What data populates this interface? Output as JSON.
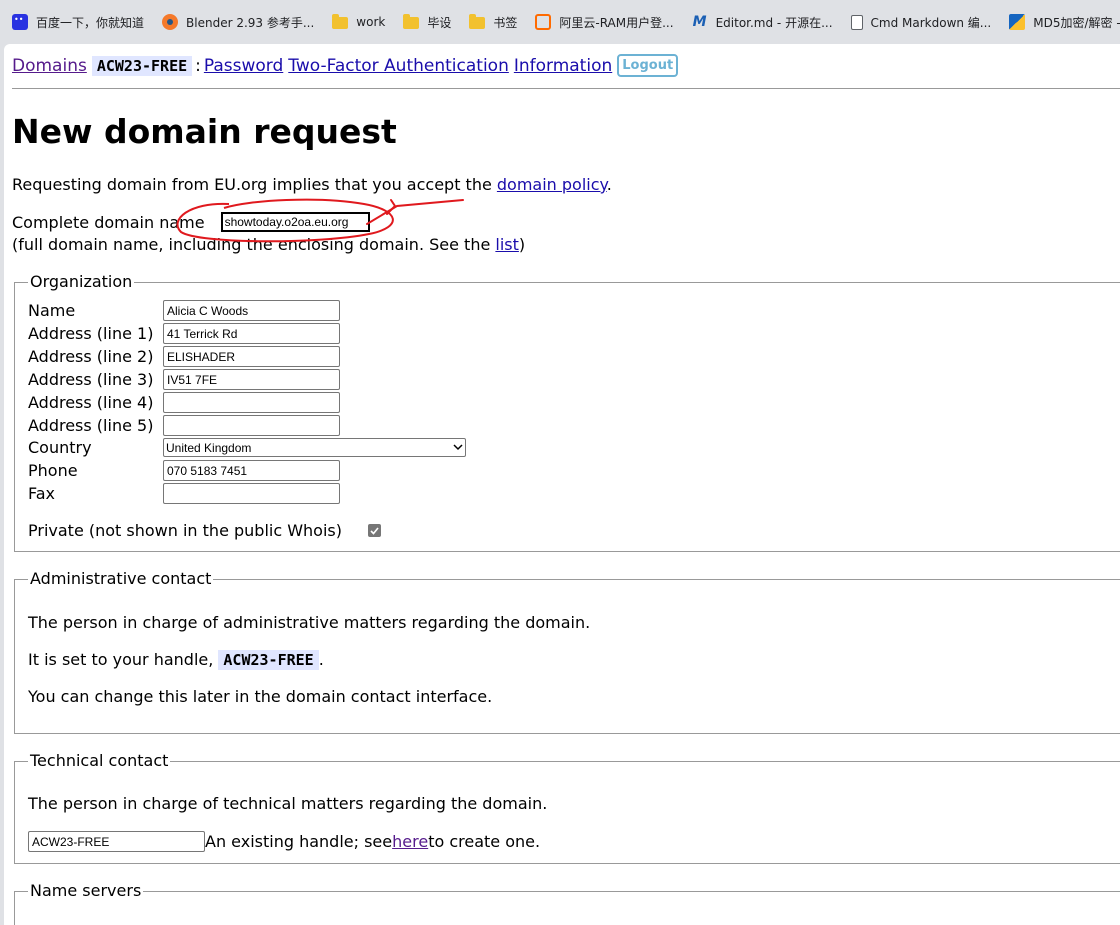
{
  "bookmarks": [
    {
      "label": "百度一下，你就知道",
      "icon": "baidu-icon"
    },
    {
      "label": "Blender 2.93 参考手...",
      "icon": "blender-icon"
    },
    {
      "label": "work",
      "icon": "folder-icon"
    },
    {
      "label": "毕设",
      "icon": "folder-icon"
    },
    {
      "label": "书签",
      "icon": "folder-icon"
    },
    {
      "label": "阿里云-RAM用户登...",
      "icon": "aliyun-icon"
    },
    {
      "label": "Editor.md - 开源在...",
      "icon": "editormd-icon"
    },
    {
      "label": "Cmd Markdown 编...",
      "icon": "document-icon"
    },
    {
      "label": "MD5加密/解密 - 站...",
      "icon": "md5-icon"
    }
  ],
  "nav": {
    "domains": "Domains",
    "handle": "ACW23-FREE",
    "sep": ":",
    "password": "Password",
    "two_factor": "Two-Factor Authentication",
    "information": "Information",
    "logout": "Logout"
  },
  "title": "New domain request",
  "intro": {
    "text": "Requesting domain from EU.org implies that you accept the ",
    "link": "domain policy",
    "end": "."
  },
  "domain": {
    "label": "Complete domain name",
    "value": "showtoday.o2oa.eu.org",
    "help_pre": "(full domain name, including the enclosing domain. See the ",
    "help_link": "list",
    "help_post": ")"
  },
  "organization": {
    "legend": "Organization",
    "name_label": "Name",
    "name_value": "Alicia C Woods",
    "addr1_label": "Address (line 1)",
    "addr1_value": "41 Terrick Rd",
    "addr2_label": "Address (line 2)",
    "addr2_value": "ELISHADER",
    "addr3_label": "Address (line 3)",
    "addr3_value": "IV51 7FE",
    "addr4_label": "Address (line 4)",
    "addr4_value": "",
    "addr5_label": "Address (line 5)",
    "addr5_value": "",
    "country_label": "Country",
    "country_value": "United Kingdom",
    "phone_label": "Phone",
    "phone_value": "070 5183 7451",
    "fax_label": "Fax",
    "fax_value": "",
    "private_label": "Private (not shown in the public Whois)",
    "private_checked": true
  },
  "admin": {
    "legend": "Administrative contact",
    "line1": "The person in charge of administrative matters regarding the domain.",
    "line2_pre": "It is set to your handle, ",
    "line2_handle": "ACW23-FREE",
    "line2_post": ".",
    "line3": "You can change this later in the domain contact interface."
  },
  "technical": {
    "legend": "Technical contact",
    "line1": "The person in charge of technical matters regarding the domain.",
    "handle_value": "ACW23-FREE",
    "hint_pre": "An existing handle; see ",
    "hint_link": "here",
    "hint_post": " to create one."
  },
  "nameservers": {
    "legend": "Name servers"
  },
  "colors": {
    "link": "#1a0dab",
    "visited": "#551a8b",
    "handle_bg": "#e0e6ff",
    "logout": "#6cb2d4",
    "annotation": "#e0191e"
  }
}
